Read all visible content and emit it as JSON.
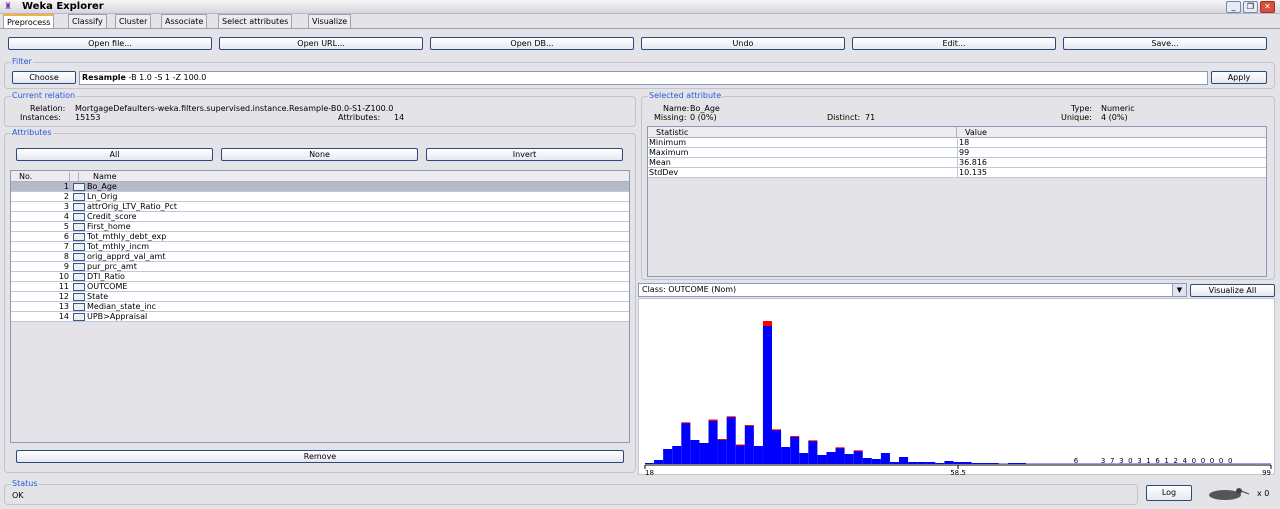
{
  "window": {
    "title": "Weka Explorer",
    "controls": [
      "minimize",
      "maximize",
      "close"
    ]
  },
  "tabs": [
    "Preprocess",
    "Classify",
    "Cluster",
    "Associate",
    "Select attributes",
    "Visualize"
  ],
  "active_tab": "Preprocess",
  "toolbar": {
    "open_file": "Open file...",
    "open_url": "Open URL...",
    "open_db": "Open DB...",
    "undo": "Undo",
    "edit": "Edit...",
    "save": "Save..."
  },
  "filter": {
    "label": "Filter",
    "choose": "Choose",
    "name": "Resample",
    "options": " -B 1.0 -S 1 -Z 100.0",
    "apply": "Apply"
  },
  "current_relation": {
    "label": "Current relation",
    "relation_label": "Relation:",
    "relation": "MortgageDefaulters-weka.filters.supervised.instance.Resample-B0.0-S1-Z100.0",
    "instances_label": "Instances:",
    "instances": "15153",
    "attributes_label": "Attributes:",
    "attributes": "14"
  },
  "attributes": {
    "label": "Attributes",
    "all": "All",
    "none": "None",
    "invert": "Invert",
    "col_no": "No.",
    "col_name": "Name",
    "remove": "Remove",
    "selected_index": 0,
    "items": [
      {
        "no": "1",
        "name": "Bo_Age"
      },
      {
        "no": "2",
        "name": "Ln_Orig"
      },
      {
        "no": "3",
        "name": "attrOrig_LTV_Ratio_Pct"
      },
      {
        "no": "4",
        "name": "Credit_score"
      },
      {
        "no": "5",
        "name": "First_home"
      },
      {
        "no": "6",
        "name": "Tot_mthly_debt_exp"
      },
      {
        "no": "7",
        "name": "Tot_mthly_incm"
      },
      {
        "no": "8",
        "name": "orig_apprd_val_amt"
      },
      {
        "no": "9",
        "name": "pur_prc_amt"
      },
      {
        "no": "10",
        "name": "DTI_Ratio"
      },
      {
        "no": "11",
        "name": "OUTCOME"
      },
      {
        "no": "12",
        "name": "State"
      },
      {
        "no": "13",
        "name": "Median_state_inc"
      },
      {
        "no": "14",
        "name": "UPB>Appraisal"
      }
    ]
  },
  "selected_attribute": {
    "label": "Selected attribute",
    "name_label": "Name:",
    "name": "Bo_Age",
    "type_label": "Type:",
    "type": "Numeric",
    "missing_label": "Missing:",
    "missing": "0 (0%)",
    "distinct_label": "Distinct:",
    "distinct": "71",
    "unique_label": "Unique:",
    "unique": "4 (0%)",
    "col_stat": "Statistic",
    "col_value": "Value",
    "stats": [
      {
        "s": "Minimum",
        "v": "18"
      },
      {
        "s": "Maximum",
        "v": "99"
      },
      {
        "s": "Mean",
        "v": "36.816"
      },
      {
        "s": "StdDev",
        "v": "10.135"
      }
    ]
  },
  "class_select": {
    "value": "Class: OUTCOME (Nom)",
    "visualize_all": "Visualize All"
  },
  "histogram": {
    "colors": {
      "class1": "#0000ff",
      "class2": "#ff0000"
    },
    "x_min_label": "18",
    "x_mid_label": "58.5",
    "x_max_label": "99",
    "counts_blue": [
      20,
      80,
      300,
      360,
      820,
      480,
      420,
      860,
      480,
      940,
      380,
      760,
      360,
      2760,
      680,
      340,
      540,
      220,
      460,
      180,
      240,
      320,
      200,
      260,
      120,
      100,
      220,
      40,
      140,
      40,
      40,
      40,
      20,
      60,
      40,
      40,
      20,
      20,
      20,
      0,
      20,
      20,
      0,
      0,
      0,
      0,
      0,
      6,
      0,
      0,
      3,
      7,
      3,
      0,
      3,
      1,
      6,
      1,
      2,
      4,
      0,
      0,
      0,
      0,
      0,
      0,
      0,
      0,
      0
    ],
    "counts_red": [
      0,
      0,
      0,
      0,
      14,
      0,
      0,
      30,
      20,
      14,
      10,
      20,
      0,
      100,
      14,
      0,
      20,
      0,
      14,
      0,
      0,
      14,
      0,
      14,
      0,
      0,
      0,
      0,
      0,
      0,
      0,
      0,
      0,
      0,
      0,
      0,
      0,
      0,
      0,
      0,
      0,
      0,
      0,
      0,
      0,
      0,
      0,
      0,
      0,
      0,
      0,
      0,
      0,
      0,
      0,
      0,
      0,
      0,
      0,
      0,
      0,
      0,
      0,
      0,
      0,
      0,
      0,
      0,
      0
    ],
    "bar_labels": [
      {
        "bin": 47,
        "text": "6"
      },
      {
        "bin": 50,
        "text": "3"
      },
      {
        "bin": 51,
        "text": "7"
      },
      {
        "bin": 52,
        "text": "3"
      },
      {
        "bin": 53,
        "text": "0"
      },
      {
        "bin": 54,
        "text": "3"
      },
      {
        "bin": 55,
        "text": "1"
      },
      {
        "bin": 56,
        "text": "6"
      },
      {
        "bin": 57,
        "text": "1"
      },
      {
        "bin": 58,
        "text": "2"
      },
      {
        "bin": 59,
        "text": "4"
      },
      {
        "bin": 60,
        "text": "0"
      },
      {
        "bin": 61,
        "text": "0"
      },
      {
        "bin": 62,
        "text": "0"
      },
      {
        "bin": 63,
        "text": "0"
      },
      {
        "bin": 64,
        "text": "0"
      }
    ]
  },
  "status": {
    "label": "Status",
    "text": "OK",
    "log": "Log",
    "tasks": "x 0"
  }
}
